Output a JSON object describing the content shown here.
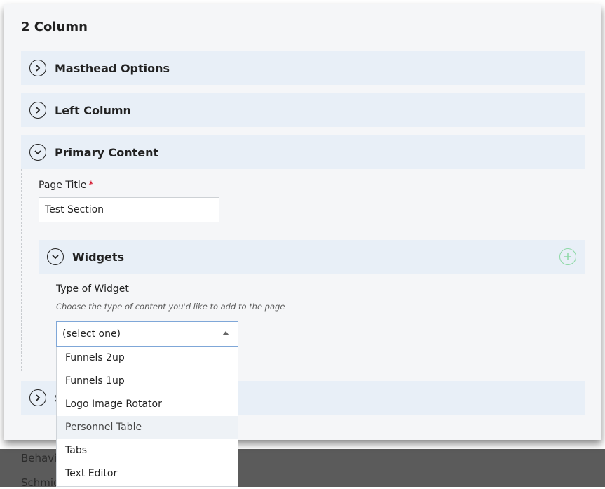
{
  "panel": {
    "title": "2 Column"
  },
  "sections": [
    {
      "label": "Masthead Options",
      "state": "collapsed"
    },
    {
      "label": "Left Column",
      "state": "collapsed"
    },
    {
      "label": "Primary Content",
      "state": "expanded"
    },
    {
      "label": "S",
      "state": "collapsed"
    }
  ],
  "primary_content": {
    "page_title_label": "Page Title",
    "required_mark": "*",
    "page_title_value": "Test Section",
    "widgets": {
      "label": "Widgets",
      "type_label": "Type of Widget",
      "type_hint": "Choose the type of content you'd like to add to the page",
      "select_value": "(select one)",
      "options": [
        "Funnels 2up",
        "Funnels 1up",
        "Logo Image Rotator",
        "Personnel Table",
        "Tabs",
        "Text Editor"
      ],
      "hovered_option": "Personnel Table"
    }
  },
  "background_rows": [
    "Behavi",
    "Schmid"
  ],
  "colors": {
    "panel_bg": "#f5f6f8",
    "section_bg": "#e8eff7",
    "required": "#d0021b",
    "add_icon": "#8ed9a6",
    "select_focus": "#7fa7d8"
  },
  "icons": {
    "collapsed": "chevron-right-icon",
    "expanded": "chevron-down-icon",
    "add": "plus-circle-icon",
    "select_caret": "caret-up-icon"
  }
}
